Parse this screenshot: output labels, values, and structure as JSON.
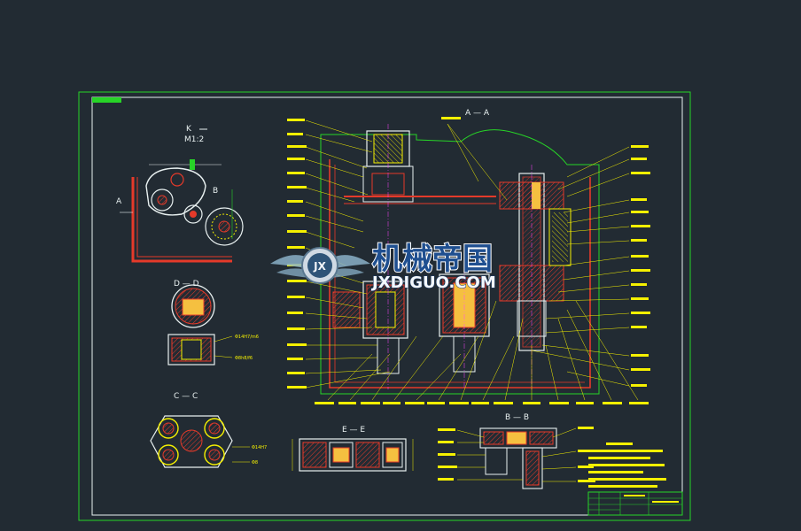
{
  "drawing": {
    "background": "#222b33",
    "colors": {
      "frame": "#27d427",
      "annotation": "#f5f000",
      "red": "#e53a2a",
      "white": "#e8f0f0",
      "cyan": "#00c8e6",
      "magenta": "#ff44ff"
    },
    "view_labels": {
      "k": "K",
      "k_scale": "M1:2",
      "a": "A",
      "b": "B",
      "aa": "A — A",
      "dd": "D — D",
      "cc": "C — C",
      "ee": "E — E",
      "bb": "B — B"
    }
  },
  "watermark": {
    "title": "机械帝国",
    "url": "JXDIGUO.COM",
    "logo_text": "JX"
  }
}
